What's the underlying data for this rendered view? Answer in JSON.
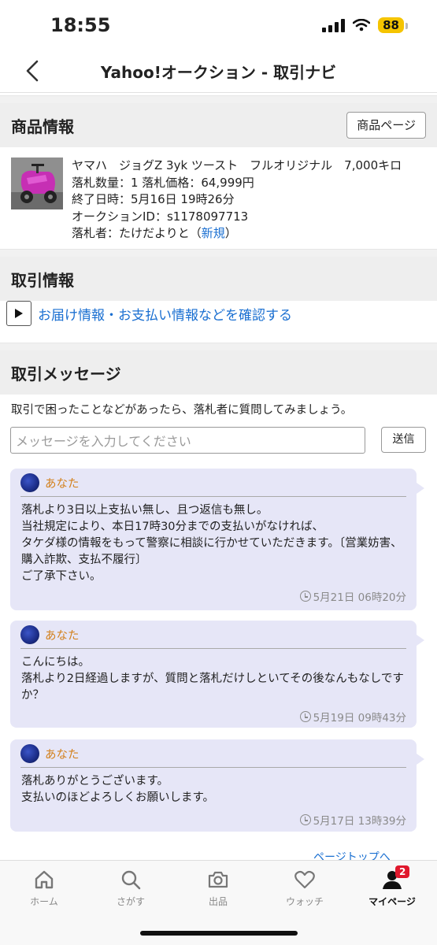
{
  "status_bar": {
    "time": "18:55",
    "battery": "88"
  },
  "nav": {
    "title": "Yahoo!オークション - 取引ナビ"
  },
  "product": {
    "header": "商品情報",
    "page_button": "商品ページ",
    "title": "ヤマハ　ジョグZ 3yk ツースト　フルオリジナル　7,000キロ",
    "quantity_price": "落札数量：1 落札価格：64,999円",
    "end_date": "終了日時：5月16日 19時26分",
    "auction_id": "オークションID：s1178097713",
    "winner_prefix": "落札者：たけだよりと（",
    "winner_new": "新規",
    "winner_suffix": "）"
  },
  "transaction": {
    "header": "取引情報",
    "confirm_link": "お届け情報・お支払い情報などを確認する"
  },
  "messages": {
    "header": "取引メッセージ",
    "help": "取引で困ったことなどがあったら、落札者に質問してみましょう。",
    "input_placeholder": "メッセージを入力してください",
    "send_button": "送信",
    "items": [
      {
        "sender": "あなた",
        "body": "落札より3日以上支払い無し、且つ返信も無し。\n当社規定により、本日17時30分までの支払いがなければ、\nタケダ様の情報をもって警察に相談に行かせていただきます。〔営業妨害、購入詐欺、支払不履行〕\nご了承下さい。",
        "time": "5月21日 06時20分"
      },
      {
        "sender": "あなた",
        "body": "こんにちは。\n落札より2日経過しますが、質問と落札だけしといてその後なんもなしですか？",
        "time": "5月19日 09時43分"
      },
      {
        "sender": "あなた",
        "body": "落札ありがとうございます。\n支払いのほどよろしくお願いします。",
        "time": "5月17日 13時39分"
      }
    ],
    "page_top": "ページトップへ"
  },
  "tabs": [
    {
      "label": "ホーム",
      "icon": "home-icon"
    },
    {
      "label": "さがす",
      "icon": "search-icon"
    },
    {
      "label": "出品",
      "icon": "camera-icon"
    },
    {
      "label": "ウォッチ",
      "icon": "heart-icon"
    },
    {
      "label": "マイページ",
      "icon": "user-icon",
      "badge": "2",
      "active": true
    }
  ],
  "colors": {
    "link": "#1a6fd1",
    "sender": "#d3801b",
    "message_bg": "#e6e6f7",
    "badge": "#e0182d"
  }
}
